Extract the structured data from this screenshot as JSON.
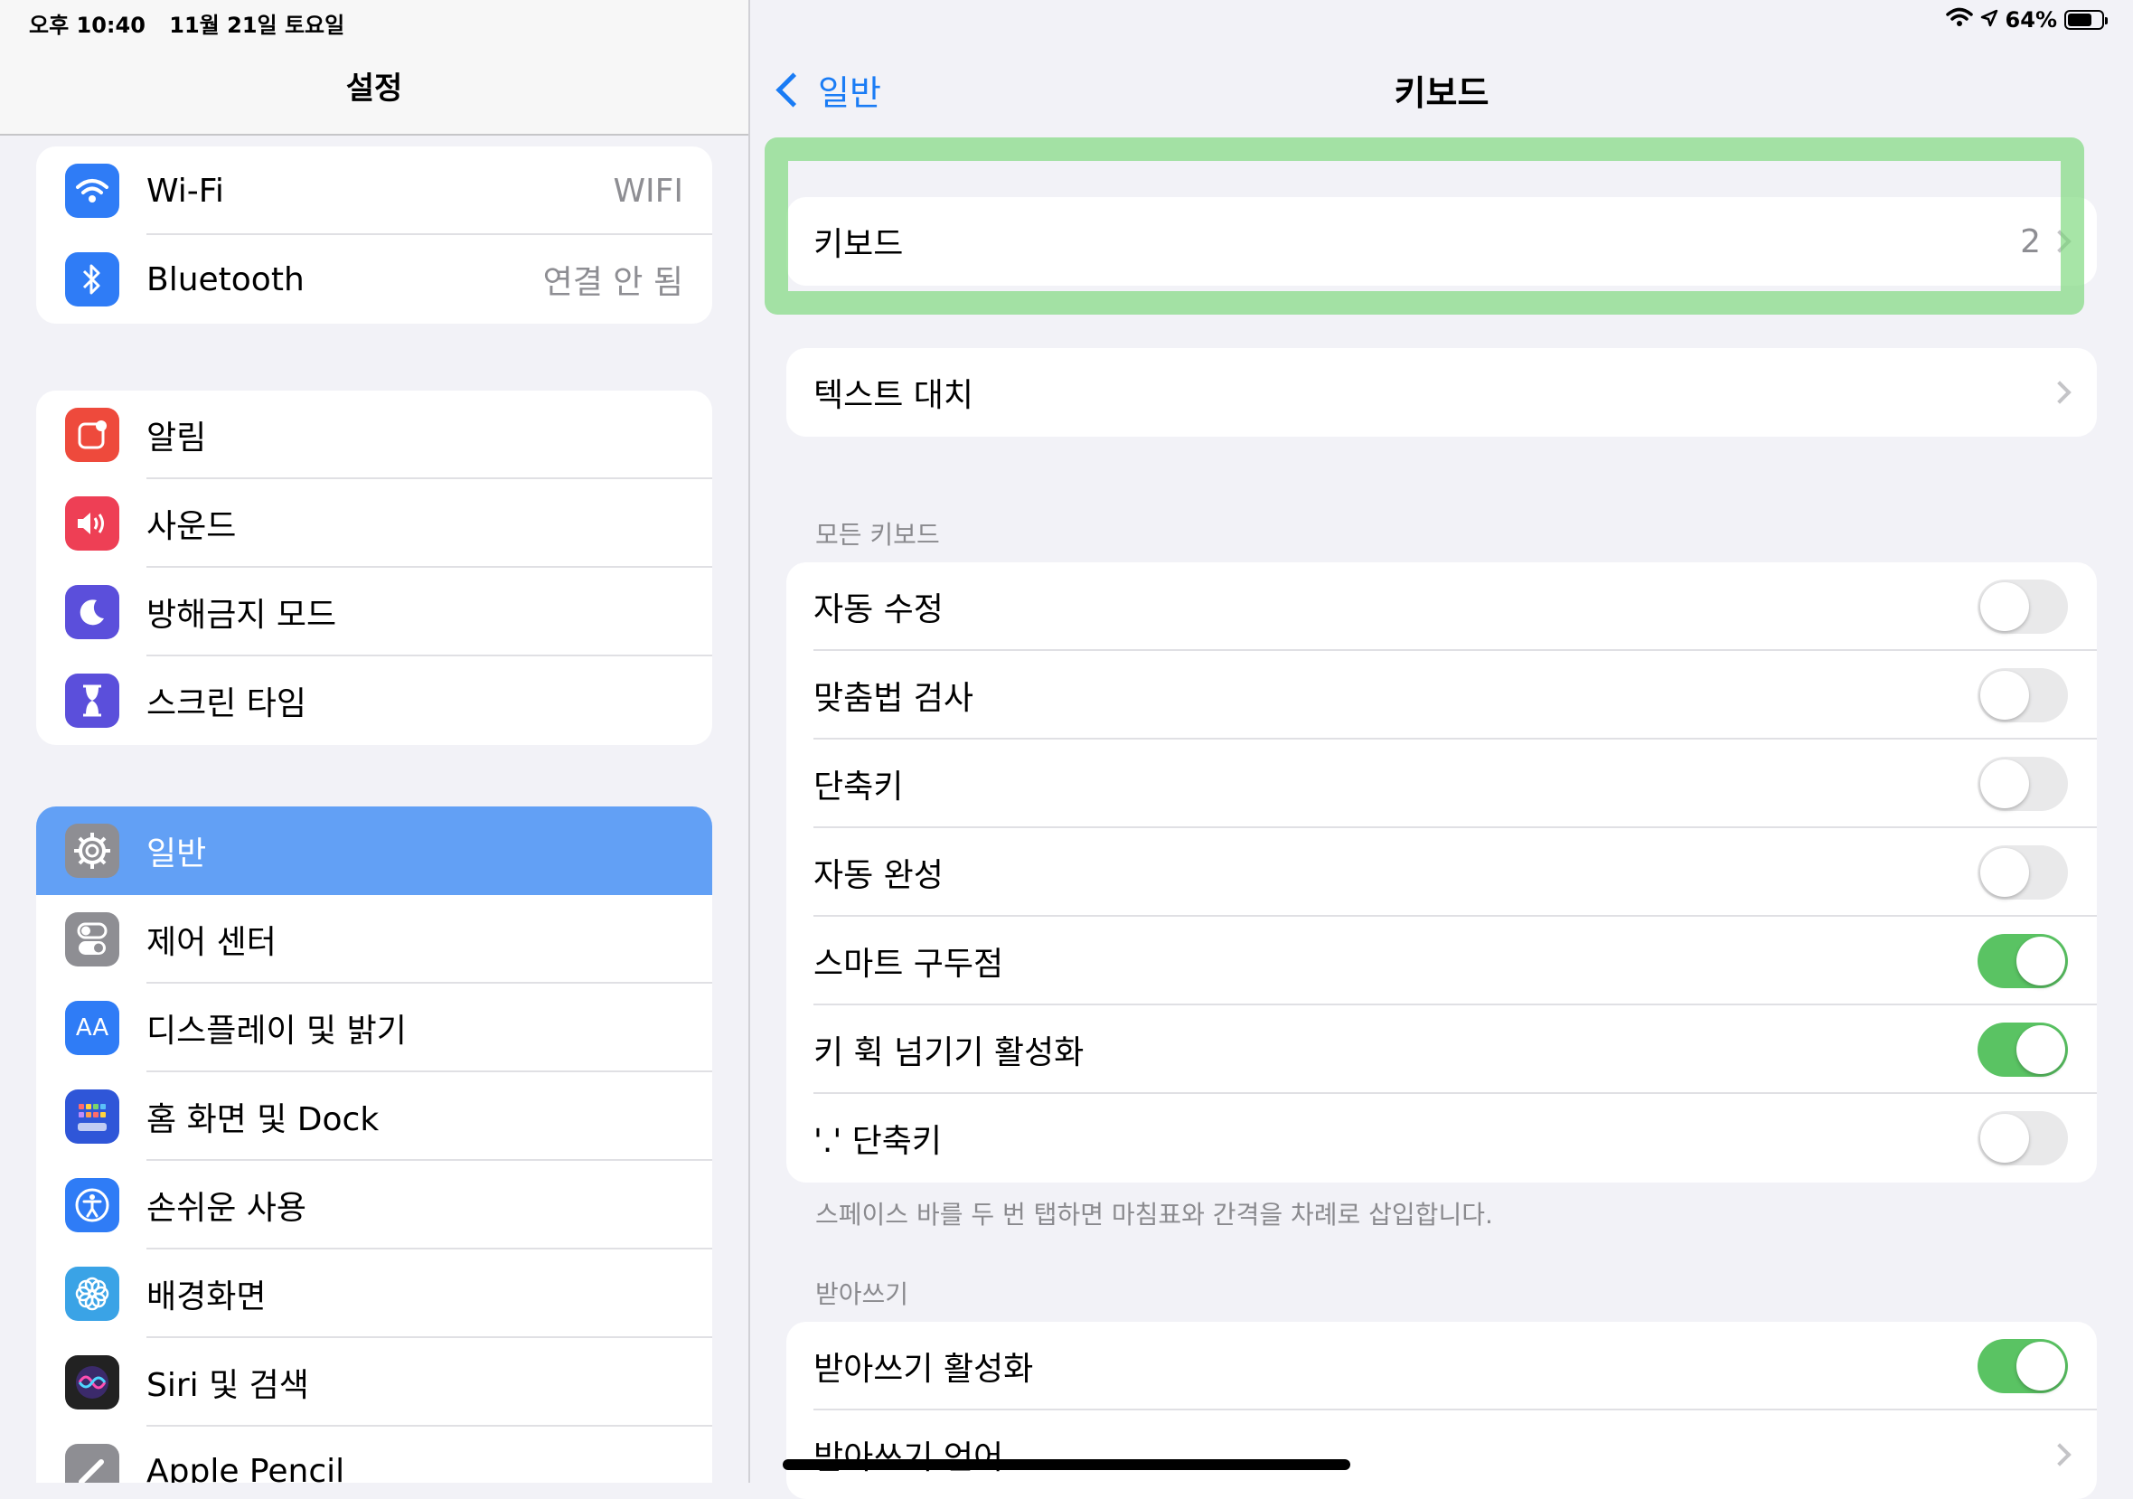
{
  "status": {
    "time": "오후 10:40",
    "date": "11월 21일 토요일",
    "battery": "64%"
  },
  "left": {
    "title": "설정",
    "group1": [
      {
        "label": "Wi-Fi",
        "value": "WIFI",
        "icon": "wifi-icon",
        "color": "#2f7cf6"
      },
      {
        "label": "Bluetooth",
        "value": "연결 안 됨",
        "icon": "bluetooth-icon",
        "color": "#2f7cf6"
      }
    ],
    "group2": [
      {
        "label": "알림",
        "icon": "notifications-icon",
        "color": "#ee4a3c"
      },
      {
        "label": "사운드",
        "icon": "sound-icon",
        "color": "#ee3f55"
      },
      {
        "label": "방해금지 모드",
        "icon": "moon-icon",
        "color": "#5b4fdb"
      },
      {
        "label": "스크린 타임",
        "icon": "hourglass-icon",
        "color": "#5b4fdb"
      }
    ],
    "group3": [
      {
        "label": "일반",
        "icon": "gear-icon",
        "color": "#8e8e93",
        "selected": true
      },
      {
        "label": "제어 센터",
        "icon": "control-center-icon",
        "color": "#8e8e93"
      },
      {
        "label": "디스플레이 및 밝기",
        "icon": "display-icon",
        "color": "#2f7cf6"
      },
      {
        "label": "홈 화면 및 Dock",
        "icon": "home-screen-icon",
        "color": "#2f56d8"
      },
      {
        "label": "손쉬운 사용",
        "icon": "accessibility-icon",
        "color": "#2f7cf6"
      },
      {
        "label": "배경화면",
        "icon": "wallpaper-icon",
        "color": "#3aa3e6"
      },
      {
        "label": "Siri 및 검색",
        "icon": "siri-icon",
        "color": "#222222"
      },
      {
        "label": "Apple Pencil",
        "icon": "pencil-icon",
        "color": "#8e8e93"
      }
    ],
    "selected_color": "#62a0f5"
  },
  "right": {
    "back": "일반",
    "title": "키보드",
    "keyboards": {
      "label": "키보드",
      "value": "2"
    },
    "text_replacement": {
      "label": "텍스트 대치"
    },
    "all_keyboards_header": "모든 키보드",
    "all_keyboards": [
      {
        "label": "자동 수정",
        "on": false
      },
      {
        "label": "맞춤법 검사",
        "on": false
      },
      {
        "label": "단축키",
        "on": false
      },
      {
        "label": "자동 완성",
        "on": false
      },
      {
        "label": "스마트 구두점",
        "on": true
      },
      {
        "label": "키 휙 넘기기 활성화",
        "on": true
      },
      {
        "label": "'.' 단축키",
        "on": false
      }
    ],
    "period_footer": "스페이스 바를 두 번 탭하면 마침표와 간격을 차례로 삽입합니다.",
    "dictation_header": "받아쓰기",
    "dictation": [
      {
        "label": "받아쓰기 활성화",
        "on": true
      },
      {
        "label": "받아쓰기 언어"
      }
    ],
    "toggle_on_color": "#5ac363",
    "accent": "#1a7cf5"
  }
}
